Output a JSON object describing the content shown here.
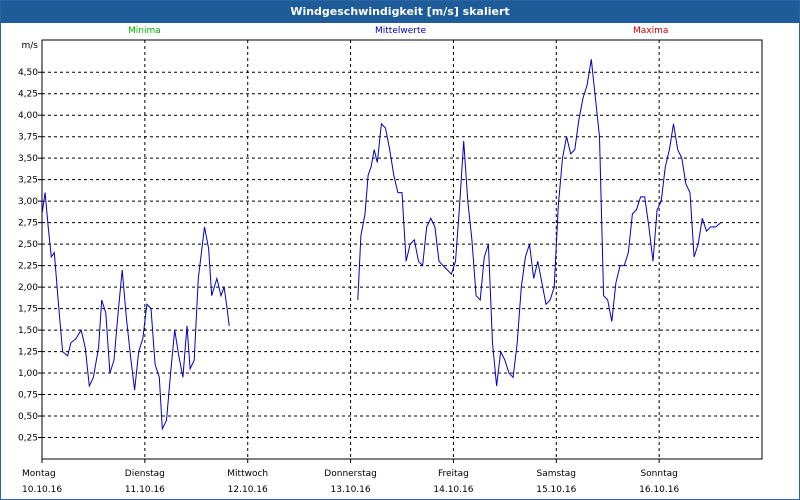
{
  "window": {
    "title": "Windgeschwindigkeit [m/s] skaliert"
  },
  "legend": [
    {
      "label": "Minima",
      "color": "#00b400"
    },
    {
      "label": "Mittelwerte",
      "color": "#0000c8"
    },
    {
      "label": "Maxima",
      "color": "#c80000"
    }
  ],
  "chart_data": {
    "type": "line",
    "ylabel": "m/s",
    "ylim": [
      0,
      4.875
    ],
    "y_ticks": [
      "0,25",
      "0,50",
      "0,75",
      "1,00",
      "1,25",
      "1,50",
      "1,75",
      "2,00",
      "2,25",
      "2,50",
      "2,75",
      "3,00",
      "3,25",
      "3,50",
      "3,75",
      "4,00",
      "4,25",
      "4,50"
    ],
    "x_range": [
      0,
      7
    ],
    "grid": true,
    "x_ticks": [
      {
        "day": "Montag",
        "date": "10.10.16"
      },
      {
        "day": "Dienstag",
        "date": "11.10.16"
      },
      {
        "day": "Mittwoch",
        "date": "12.10.16"
      },
      {
        "day": "Donnerstag",
        "date": "13.10.16"
      },
      {
        "day": "Freitag",
        "date": "14.10.16"
      },
      {
        "day": "Samstag",
        "date": "15.10.16"
      },
      {
        "day": "Sonntag",
        "date": "16.10.16"
      }
    ],
    "series": [
      {
        "name": "Mittelwerte",
        "color": "#0000c8",
        "segments": [
          [
            [
              0.0,
              2.85
            ],
            [
              0.03,
              3.1
            ],
            [
              0.06,
              2.7
            ],
            [
              0.09,
              2.35
            ],
            [
              0.12,
              2.4
            ],
            [
              0.16,
              1.8
            ],
            [
              0.2,
              1.25
            ],
            [
              0.25,
              1.2
            ],
            [
              0.28,
              1.35
            ],
            [
              0.33,
              1.4
            ],
            [
              0.38,
              1.5
            ],
            [
              0.42,
              1.3
            ],
            [
              0.46,
              0.85
            ],
            [
              0.5,
              0.95
            ],
            [
              0.55,
              1.3
            ],
            [
              0.58,
              1.85
            ],
            [
              0.62,
              1.7
            ],
            [
              0.66,
              1.0
            ],
            [
              0.7,
              1.15
            ],
            [
              0.74,
              1.7
            ],
            [
              0.78,
              2.2
            ],
            [
              0.82,
              1.65
            ],
            [
              0.86,
              1.2
            ],
            [
              0.9,
              0.8
            ],
            [
              0.94,
              1.25
            ],
            [
              0.98,
              1.4
            ],
            [
              1.02,
              1.8
            ],
            [
              1.06,
              1.75
            ],
            [
              1.1,
              1.1
            ],
            [
              1.14,
              0.95
            ],
            [
              1.17,
              0.35
            ],
            [
              1.21,
              0.45
            ],
            [
              1.25,
              1.0
            ],
            [
              1.29,
              1.5
            ],
            [
              1.33,
              1.2
            ],
            [
              1.37,
              0.95
            ],
            [
              1.41,
              1.55
            ],
            [
              1.44,
              1.05
            ],
            [
              1.48,
              1.15
            ],
            [
              1.52,
              2.1
            ],
            [
              1.55,
              2.4
            ],
            [
              1.58,
              2.7
            ],
            [
              1.62,
              2.45
            ],
            [
              1.65,
              1.9
            ],
            [
              1.7,
              2.1
            ],
            [
              1.74,
              1.9
            ],
            [
              1.77,
              2.0
            ],
            [
              1.8,
              1.75
            ],
            [
              1.82,
              1.55
            ]
          ],
          [
            [
              3.07,
              1.85
            ],
            [
              3.1,
              2.6
            ],
            [
              3.14,
              2.85
            ],
            [
              3.17,
              3.3
            ],
            [
              3.2,
              3.4
            ],
            [
              3.23,
              3.6
            ],
            [
              3.26,
              3.45
            ],
            [
              3.3,
              3.9
            ],
            [
              3.34,
              3.85
            ],
            [
              3.38,
              3.6
            ],
            [
              3.42,
              3.3
            ],
            [
              3.46,
              3.1
            ],
            [
              3.5,
              3.1
            ],
            [
              3.54,
              2.3
            ],
            [
              3.58,
              2.5
            ],
            [
              3.62,
              2.55
            ],
            [
              3.66,
              2.3
            ],
            [
              3.7,
              2.25
            ],
            [
              3.74,
              2.7
            ],
            [
              3.78,
              2.8
            ],
            [
              3.82,
              2.7
            ],
            [
              3.86,
              2.3
            ],
            [
              3.9,
              2.25
            ],
            [
              3.94,
              2.2
            ],
            [
              3.98,
              2.15
            ],
            [
              4.02,
              2.3
            ],
            [
              4.06,
              2.95
            ],
            [
              4.1,
              3.7
            ],
            [
              4.14,
              3.0
            ],
            [
              4.18,
              2.55
            ],
            [
              4.22,
              1.9
            ],
            [
              4.26,
              1.85
            ],
            [
              4.3,
              2.35
            ],
            [
              4.34,
              2.5
            ],
            [
              4.38,
              1.35
            ],
            [
              4.42,
              0.85
            ],
            [
              4.46,
              1.25
            ],
            [
              4.5,
              1.15
            ],
            [
              4.54,
              1.0
            ],
            [
              4.58,
              0.95
            ],
            [
              4.62,
              1.35
            ],
            [
              4.66,
              2.0
            ],
            [
              4.7,
              2.35
            ],
            [
              4.74,
              2.5
            ],
            [
              4.78,
              2.1
            ],
            [
              4.82,
              2.3
            ],
            [
              4.86,
              2.05
            ],
            [
              4.9,
              1.8
            ],
            [
              4.94,
              1.85
            ],
            [
              4.98,
              2.0
            ],
            [
              5.02,
              2.95
            ],
            [
              5.06,
              3.5
            ],
            [
              5.1,
              3.75
            ],
            [
              5.14,
              3.55
            ],
            [
              5.18,
              3.6
            ],
            [
              5.22,
              3.95
            ],
            [
              5.26,
              4.2
            ],
            [
              5.3,
              4.35
            ],
            [
              5.34,
              4.65
            ],
            [
              5.38,
              4.2
            ],
            [
              5.42,
              3.75
            ],
            [
              5.46,
              1.9
            ],
            [
              5.5,
              1.85
            ],
            [
              5.54,
              1.6
            ],
            [
              5.58,
              2.05
            ],
            [
              5.62,
              2.25
            ],
            [
              5.66,
              2.25
            ],
            [
              5.7,
              2.4
            ],
            [
              5.74,
              2.85
            ],
            [
              5.78,
              2.9
            ],
            [
              5.82,
              3.05
            ],
            [
              5.86,
              3.05
            ],
            [
              5.9,
              2.7
            ],
            [
              5.94,
              2.3
            ],
            [
              5.98,
              2.9
            ],
            [
              6.02,
              3.0
            ],
            [
              6.06,
              3.4
            ],
            [
              6.1,
              3.6
            ],
            [
              6.14,
              3.9
            ],
            [
              6.18,
              3.6
            ],
            [
              6.22,
              3.5
            ],
            [
              6.26,
              3.2
            ],
            [
              6.3,
              3.1
            ],
            [
              6.34,
              2.35
            ],
            [
              6.38,
              2.5
            ],
            [
              6.42,
              2.8
            ],
            [
              6.46,
              2.65
            ],
            [
              6.5,
              2.7
            ],
            [
              6.55,
              2.7
            ],
            [
              6.6,
              2.75
            ]
          ]
        ]
      }
    ]
  }
}
